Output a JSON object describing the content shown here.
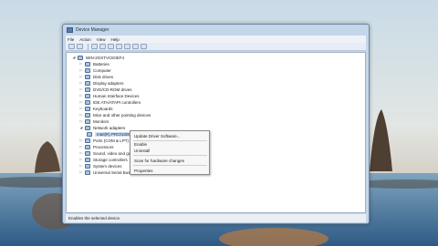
{
  "window": {
    "title": "Device Manager"
  },
  "menubar": {
    "items": [
      "File",
      "Action",
      "View",
      "Help"
    ]
  },
  "tree": {
    "root": "WIN-2GSTVCE0EF4",
    "items": [
      {
        "label": "Batteries"
      },
      {
        "label": "Computer"
      },
      {
        "label": "Disk drives"
      },
      {
        "label": "Display adapters"
      },
      {
        "label": "DVD/CD-ROM drives"
      },
      {
        "label": "Human Interface Devices"
      },
      {
        "label": "IDE ATA/ATAPI controllers"
      },
      {
        "label": "Keyboards"
      },
      {
        "label": "Mice and other pointing devices"
      },
      {
        "label": "Monitors"
      },
      {
        "label": "Network adapters"
      },
      {
        "label": "Intel(R) PRO/1000"
      },
      {
        "label": "Ports (COM & LPT)"
      },
      {
        "label": "Processors"
      },
      {
        "label": "Sound, video and game controllers"
      },
      {
        "label": "Storage controllers"
      },
      {
        "label": "System devices"
      },
      {
        "label": "Universal Serial Bus controllers"
      }
    ]
  },
  "context_menu": {
    "items": [
      "Update Driver Software...",
      "Enable",
      "Uninstall",
      "Scan for hardware changes",
      "Properties"
    ]
  },
  "statusbar": {
    "text": "Enables the selected device."
  }
}
